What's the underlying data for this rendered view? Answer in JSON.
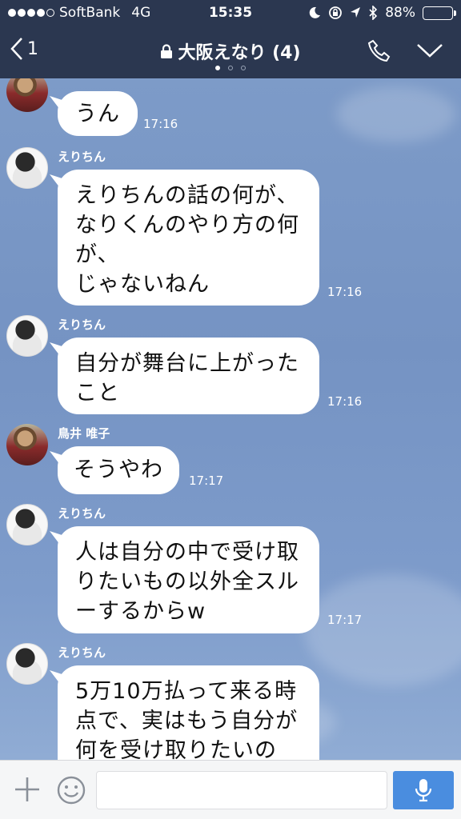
{
  "status_bar": {
    "carrier": "SoftBank",
    "network": "4G",
    "time": "15:35",
    "battery": "88%",
    "battery_level": 0.88,
    "signal_dots_filled": 4,
    "icons": [
      "moon-icon",
      "rotation-lock-icon",
      "location-icon",
      "bluetooth-icon",
      "battery-icon"
    ]
  },
  "nav": {
    "back_count": "1",
    "title": "大阪えなり (4)",
    "title_icon": "lock-icon",
    "page_indicator_count": 3,
    "active_page": 0
  },
  "messages": [
    {
      "sender": "",
      "text": "うん",
      "time": "17:16",
      "avatar": "tori"
    },
    {
      "sender": "えりちん",
      "text": "えりちんの話の何が、\nなりくんのやり方の何\nが、\nじゃないねん",
      "time": "17:16",
      "avatar": "eri"
    },
    {
      "sender": "えりちん",
      "text": "自分が舞台に上がった\nこと",
      "time": "17:16",
      "avatar": "eri"
    },
    {
      "sender": "鳥井 唯子",
      "text": "そうやわ",
      "time": "17:17",
      "avatar": "tori"
    },
    {
      "sender": "えりちん",
      "text": "人は自分の中で受け取\nりたいもの以外全スル\nーするからw",
      "time": "17:17",
      "avatar": "eri"
    },
    {
      "sender": "えりちん",
      "text": "5万10万払って来る時\n点で、実はもう自分が\n何を受け取りたいの",
      "time": "",
      "avatar": "eri"
    }
  ],
  "input": {
    "placeholder": "",
    "value": ""
  },
  "colors": {
    "header": "#2b3750",
    "chat_bg": "#7d9bc8",
    "bubble": "#ffffff",
    "mic_button": "#4a8ddf"
  }
}
